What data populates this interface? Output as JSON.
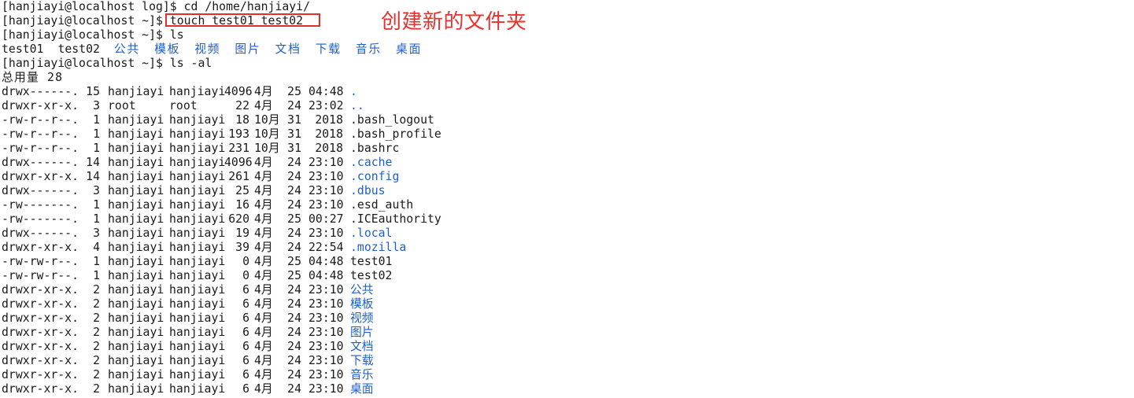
{
  "terminal": {
    "prompt_lines": [
      {
        "prompt": "[hanjiayi@localhost log]$",
        "command": "cd /home/hanjiayi/"
      },
      {
        "prompt": "[hanjiayi@localhost ~]$",
        "command": "touch test01 test02"
      },
      {
        "prompt": "[hanjiayi@localhost ~]$",
        "command": "ls"
      }
    ],
    "ls_output": {
      "files": [
        "test01",
        "test02"
      ],
      "dirs": [
        "公共",
        "模板",
        "视频",
        "图片",
        "文档",
        "下载",
        "音乐",
        "桌面"
      ]
    },
    "prompt_ls_al": {
      "prompt": "[hanjiayi@localhost ~]$",
      "command": "ls -al"
    },
    "total": "总用量 28",
    "listing": [
      {
        "perm": "drwx------.",
        "links": "15",
        "user": "hanjiayi",
        "group": "hanjiayi",
        "size": "4096",
        "month": "4月",
        "day": "25",
        "time": "04:48",
        "name": ".",
        "type": "dir"
      },
      {
        "perm": "drwxr-xr-x.",
        "links": "3",
        "user": "root",
        "group": "root",
        "size": "22",
        "month": "4月",
        "day": "24",
        "time": "23:02",
        "name": "..",
        "type": "dir"
      },
      {
        "perm": "-rw-r--r--.",
        "links": "1",
        "user": "hanjiayi",
        "group": "hanjiayi",
        "size": "18",
        "month": "10月",
        "day": "31",
        "time": "2018",
        "name": ".bash_logout",
        "type": "file"
      },
      {
        "perm": "-rw-r--r--.",
        "links": "1",
        "user": "hanjiayi",
        "group": "hanjiayi",
        "size": "193",
        "month": "10月",
        "day": "31",
        "time": "2018",
        "name": ".bash_profile",
        "type": "file"
      },
      {
        "perm": "-rw-r--r--.",
        "links": "1",
        "user": "hanjiayi",
        "group": "hanjiayi",
        "size": "231",
        "month": "10月",
        "day": "31",
        "time": "2018",
        "name": ".bashrc",
        "type": "file"
      },
      {
        "perm": "drwx------.",
        "links": "14",
        "user": "hanjiayi",
        "group": "hanjiayi",
        "size": "4096",
        "month": "4月",
        "day": "24",
        "time": "23:10",
        "name": ".cache",
        "type": "dir"
      },
      {
        "perm": "drwxr-xr-x.",
        "links": "14",
        "user": "hanjiayi",
        "group": "hanjiayi",
        "size": "261",
        "month": "4月",
        "day": "24",
        "time": "23:10",
        "name": ".config",
        "type": "dir"
      },
      {
        "perm": "drwx------.",
        "links": "3",
        "user": "hanjiayi",
        "group": "hanjiayi",
        "size": "25",
        "month": "4月",
        "day": "24",
        "time": "23:10",
        "name": ".dbus",
        "type": "dir"
      },
      {
        "perm": "-rw-------.",
        "links": "1",
        "user": "hanjiayi",
        "group": "hanjiayi",
        "size": "16",
        "month": "4月",
        "day": "24",
        "time": "23:10",
        "name": ".esd_auth",
        "type": "file"
      },
      {
        "perm": "-rw-------.",
        "links": "1",
        "user": "hanjiayi",
        "group": "hanjiayi",
        "size": "620",
        "month": "4月",
        "day": "25",
        "time": "00:27",
        "name": ".ICEauthority",
        "type": "file"
      },
      {
        "perm": "drwx------.",
        "links": "3",
        "user": "hanjiayi",
        "group": "hanjiayi",
        "size": "19",
        "month": "4月",
        "day": "24",
        "time": "23:10",
        "name": ".local",
        "type": "dir"
      },
      {
        "perm": "drwxr-xr-x.",
        "links": "4",
        "user": "hanjiayi",
        "group": "hanjiayi",
        "size": "39",
        "month": "4月",
        "day": "24",
        "time": "22:54",
        "name": ".mozilla",
        "type": "dir"
      },
      {
        "perm": "-rw-rw-r--.",
        "links": "1",
        "user": "hanjiayi",
        "group": "hanjiayi",
        "size": "0",
        "month": "4月",
        "day": "25",
        "time": "04:48",
        "name": "test01",
        "type": "file"
      },
      {
        "perm": "-rw-rw-r--.",
        "links": "1",
        "user": "hanjiayi",
        "group": "hanjiayi",
        "size": "0",
        "month": "4月",
        "day": "25",
        "time": "04:48",
        "name": "test02",
        "type": "file"
      },
      {
        "perm": "drwxr-xr-x.",
        "links": "2",
        "user": "hanjiayi",
        "group": "hanjiayi",
        "size": "6",
        "month": "4月",
        "day": "24",
        "time": "23:10",
        "name": "公共",
        "type": "dir"
      },
      {
        "perm": "drwxr-xr-x.",
        "links": "2",
        "user": "hanjiayi",
        "group": "hanjiayi",
        "size": "6",
        "month": "4月",
        "day": "24",
        "time": "23:10",
        "name": "模板",
        "type": "dir"
      },
      {
        "perm": "drwxr-xr-x.",
        "links": "2",
        "user": "hanjiayi",
        "group": "hanjiayi",
        "size": "6",
        "month": "4月",
        "day": "24",
        "time": "23:10",
        "name": "视频",
        "type": "dir"
      },
      {
        "perm": "drwxr-xr-x.",
        "links": "2",
        "user": "hanjiayi",
        "group": "hanjiayi",
        "size": "6",
        "month": "4月",
        "day": "24",
        "time": "23:10",
        "name": "图片",
        "type": "dir"
      },
      {
        "perm": "drwxr-xr-x.",
        "links": "2",
        "user": "hanjiayi",
        "group": "hanjiayi",
        "size": "6",
        "month": "4月",
        "day": "24",
        "time": "23:10",
        "name": "文档",
        "type": "dir"
      },
      {
        "perm": "drwxr-xr-x.",
        "links": "2",
        "user": "hanjiayi",
        "group": "hanjiayi",
        "size": "6",
        "month": "4月",
        "day": "24",
        "time": "23:10",
        "name": "下载",
        "type": "dir"
      },
      {
        "perm": "drwxr-xr-x.",
        "links": "2",
        "user": "hanjiayi",
        "group": "hanjiayi",
        "size": "6",
        "month": "4月",
        "day": "24",
        "time": "23:10",
        "name": "音乐",
        "type": "dir"
      },
      {
        "perm": "drwxr-xr-x.",
        "links": "2",
        "user": "hanjiayi",
        "group": "hanjiayi",
        "size": "6",
        "month": "4月",
        "day": "24",
        "time": "23:10",
        "name": "桌面",
        "type": "dir"
      }
    ]
  },
  "annotation": {
    "text": "创建新的文件夹",
    "color": "#e8302c"
  },
  "colors": {
    "text": "#1a1a1a",
    "directory": "#1f5fcf",
    "highlight_border": "#e0302a",
    "background": "#ffffff"
  }
}
